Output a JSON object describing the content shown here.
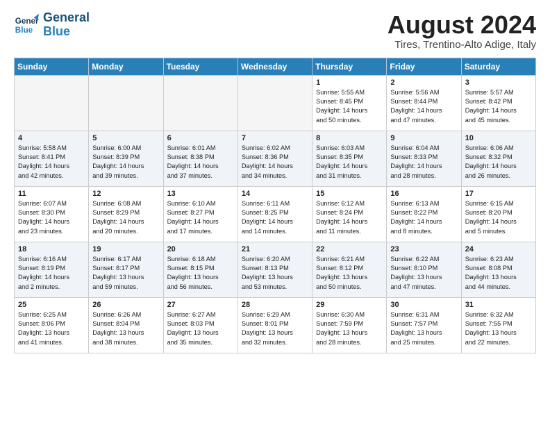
{
  "header": {
    "logo_line1": "General",
    "logo_line2": "Blue",
    "month_title": "August 2024",
    "subtitle": "Tires, Trentino-Alto Adige, Italy"
  },
  "weekdays": [
    "Sunday",
    "Monday",
    "Tuesday",
    "Wednesday",
    "Thursday",
    "Friday",
    "Saturday"
  ],
  "weeks": [
    [
      {
        "day": "",
        "info": ""
      },
      {
        "day": "",
        "info": ""
      },
      {
        "day": "",
        "info": ""
      },
      {
        "day": "",
        "info": ""
      },
      {
        "day": "1",
        "info": "Sunrise: 5:55 AM\nSunset: 8:45 PM\nDaylight: 14 hours\nand 50 minutes."
      },
      {
        "day": "2",
        "info": "Sunrise: 5:56 AM\nSunset: 8:44 PM\nDaylight: 14 hours\nand 47 minutes."
      },
      {
        "day": "3",
        "info": "Sunrise: 5:57 AM\nSunset: 8:42 PM\nDaylight: 14 hours\nand 45 minutes."
      }
    ],
    [
      {
        "day": "4",
        "info": "Sunrise: 5:58 AM\nSunset: 8:41 PM\nDaylight: 14 hours\nand 42 minutes."
      },
      {
        "day": "5",
        "info": "Sunrise: 6:00 AM\nSunset: 8:39 PM\nDaylight: 14 hours\nand 39 minutes."
      },
      {
        "day": "6",
        "info": "Sunrise: 6:01 AM\nSunset: 8:38 PM\nDaylight: 14 hours\nand 37 minutes."
      },
      {
        "day": "7",
        "info": "Sunrise: 6:02 AM\nSunset: 8:36 PM\nDaylight: 14 hours\nand 34 minutes."
      },
      {
        "day": "8",
        "info": "Sunrise: 6:03 AM\nSunset: 8:35 PM\nDaylight: 14 hours\nand 31 minutes."
      },
      {
        "day": "9",
        "info": "Sunrise: 6:04 AM\nSunset: 8:33 PM\nDaylight: 14 hours\nand 28 minutes."
      },
      {
        "day": "10",
        "info": "Sunrise: 6:06 AM\nSunset: 8:32 PM\nDaylight: 14 hours\nand 26 minutes."
      }
    ],
    [
      {
        "day": "11",
        "info": "Sunrise: 6:07 AM\nSunset: 8:30 PM\nDaylight: 14 hours\nand 23 minutes."
      },
      {
        "day": "12",
        "info": "Sunrise: 6:08 AM\nSunset: 8:29 PM\nDaylight: 14 hours\nand 20 minutes."
      },
      {
        "day": "13",
        "info": "Sunrise: 6:10 AM\nSunset: 8:27 PM\nDaylight: 14 hours\nand 17 minutes."
      },
      {
        "day": "14",
        "info": "Sunrise: 6:11 AM\nSunset: 8:25 PM\nDaylight: 14 hours\nand 14 minutes."
      },
      {
        "day": "15",
        "info": "Sunrise: 6:12 AM\nSunset: 8:24 PM\nDaylight: 14 hours\nand 11 minutes."
      },
      {
        "day": "16",
        "info": "Sunrise: 6:13 AM\nSunset: 8:22 PM\nDaylight: 14 hours\nand 8 minutes."
      },
      {
        "day": "17",
        "info": "Sunrise: 6:15 AM\nSunset: 8:20 PM\nDaylight: 14 hours\nand 5 minutes."
      }
    ],
    [
      {
        "day": "18",
        "info": "Sunrise: 6:16 AM\nSunset: 8:19 PM\nDaylight: 14 hours\nand 2 minutes."
      },
      {
        "day": "19",
        "info": "Sunrise: 6:17 AM\nSunset: 8:17 PM\nDaylight: 13 hours\nand 59 minutes."
      },
      {
        "day": "20",
        "info": "Sunrise: 6:18 AM\nSunset: 8:15 PM\nDaylight: 13 hours\nand 56 minutes."
      },
      {
        "day": "21",
        "info": "Sunrise: 6:20 AM\nSunset: 8:13 PM\nDaylight: 13 hours\nand 53 minutes."
      },
      {
        "day": "22",
        "info": "Sunrise: 6:21 AM\nSunset: 8:12 PM\nDaylight: 13 hours\nand 50 minutes."
      },
      {
        "day": "23",
        "info": "Sunrise: 6:22 AM\nSunset: 8:10 PM\nDaylight: 13 hours\nand 47 minutes."
      },
      {
        "day": "24",
        "info": "Sunrise: 6:23 AM\nSunset: 8:08 PM\nDaylight: 13 hours\nand 44 minutes."
      }
    ],
    [
      {
        "day": "25",
        "info": "Sunrise: 6:25 AM\nSunset: 8:06 PM\nDaylight: 13 hours\nand 41 minutes."
      },
      {
        "day": "26",
        "info": "Sunrise: 6:26 AM\nSunset: 8:04 PM\nDaylight: 13 hours\nand 38 minutes."
      },
      {
        "day": "27",
        "info": "Sunrise: 6:27 AM\nSunset: 8:03 PM\nDaylight: 13 hours\nand 35 minutes."
      },
      {
        "day": "28",
        "info": "Sunrise: 6:29 AM\nSunset: 8:01 PM\nDaylight: 13 hours\nand 32 minutes."
      },
      {
        "day": "29",
        "info": "Sunrise: 6:30 AM\nSunset: 7:59 PM\nDaylight: 13 hours\nand 28 minutes."
      },
      {
        "day": "30",
        "info": "Sunrise: 6:31 AM\nSunset: 7:57 PM\nDaylight: 13 hours\nand 25 minutes."
      },
      {
        "day": "31",
        "info": "Sunrise: 6:32 AM\nSunset: 7:55 PM\nDaylight: 13 hours\nand 22 minutes."
      }
    ]
  ]
}
